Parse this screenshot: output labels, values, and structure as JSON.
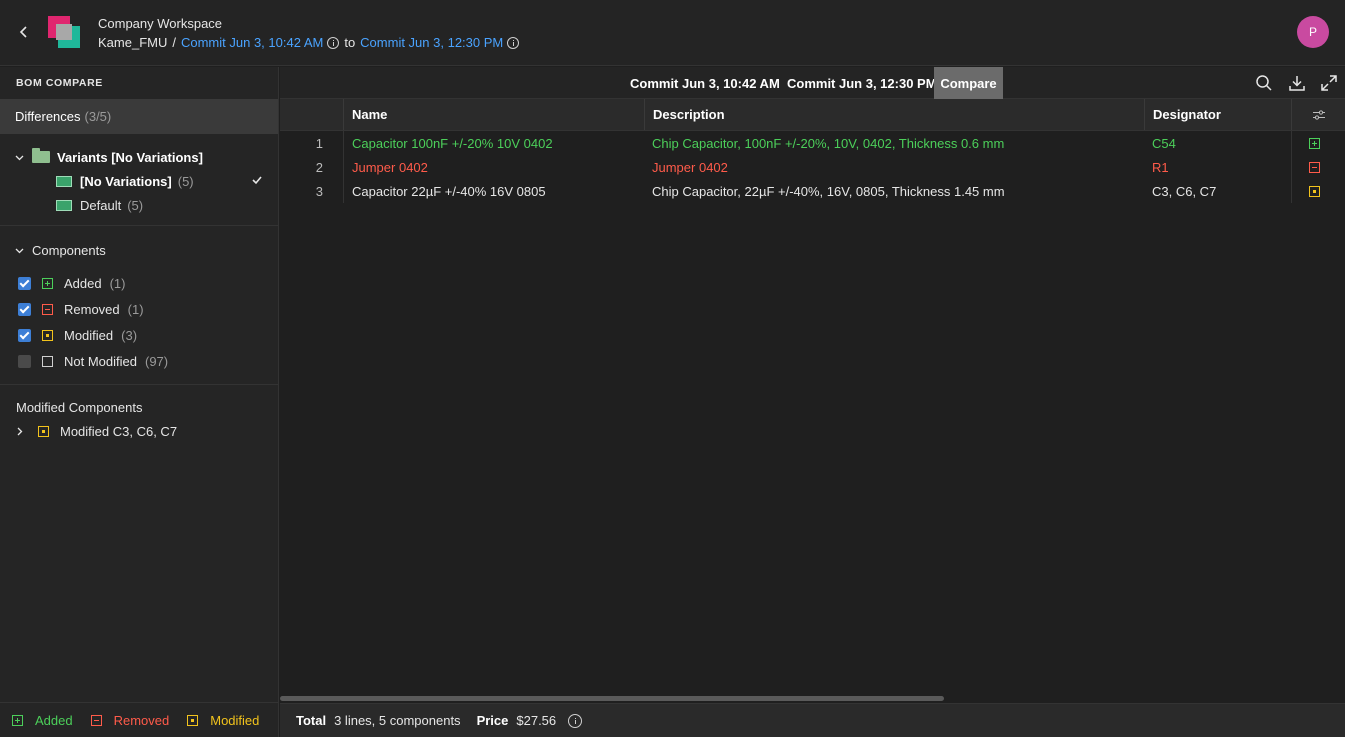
{
  "header": {
    "workspace": "Company Workspace",
    "project": "Kame_FMU",
    "separator": "/",
    "commit_from": "Commit Jun 3, 10:42 AM",
    "to_word": "to",
    "commit_to": "Commit Jun 3, 12:30 PM",
    "avatar_initial": "P",
    "avatar_color": "#c94aa0"
  },
  "sidebar": {
    "title": "BOM COMPARE",
    "differences_label": "Differences",
    "differences_count": "(3/5)",
    "variants": {
      "label": "Variants [No Variations]",
      "items": [
        {
          "label": "[No Variations]",
          "count": "(5)",
          "selected": true
        },
        {
          "label": "Default",
          "count": "(5)",
          "selected": false
        }
      ]
    },
    "components": {
      "label": "Components",
      "filters": [
        {
          "label": "Added",
          "count": "(1)",
          "checked": true,
          "kind": "added"
        },
        {
          "label": "Removed",
          "count": "(1)",
          "checked": true,
          "kind": "removed"
        },
        {
          "label": "Modified",
          "count": "(3)",
          "checked": true,
          "kind": "modified"
        },
        {
          "label": "Not Modified",
          "count": "(97)",
          "checked": false,
          "kind": "not-modified"
        }
      ]
    },
    "modified_components": {
      "label": "Modified Components",
      "items": [
        {
          "label": "Modified C3, C6, C7"
        }
      ]
    },
    "legend": {
      "added": "Added",
      "removed": "Removed",
      "modified": "Modified"
    }
  },
  "toolbar": {
    "commit_a": "Commit Jun 3, 10:42 AM",
    "commit_b": "Commit Jun 3, 12:30 PM",
    "compare_label": "Compare"
  },
  "table": {
    "columns": [
      "Name",
      "Description",
      "Designator"
    ],
    "rows": [
      {
        "num": "1",
        "name": "Capacitor 100nF +/-20% 10V 0402",
        "description": "Chip Capacitor, 100nF +/-20%, 10V, 0402, Thickness 0.6 mm",
        "designator": "C54",
        "status": "added"
      },
      {
        "num": "2",
        "name": "Jumper 0402",
        "description": "Jumper 0402",
        "designator": "R1",
        "status": "removed"
      },
      {
        "num": "3",
        "name": "Capacitor 22µF +/-40% 16V 0805",
        "description": "Chip Capacitor, 22µF +/-40%, 16V, 0805, Thickness 1.45 mm",
        "designator": "C3, C6, C7",
        "status": "modified"
      }
    ]
  },
  "footer": {
    "total_label": "Total",
    "total_value": "3 lines, 5 components",
    "price_label": "Price",
    "price_value": "$27.56"
  },
  "colors": {
    "added": "#4ccf5a",
    "removed": "#ff5b4a",
    "modified": "#f2c31c",
    "link": "#4aa3ff"
  }
}
